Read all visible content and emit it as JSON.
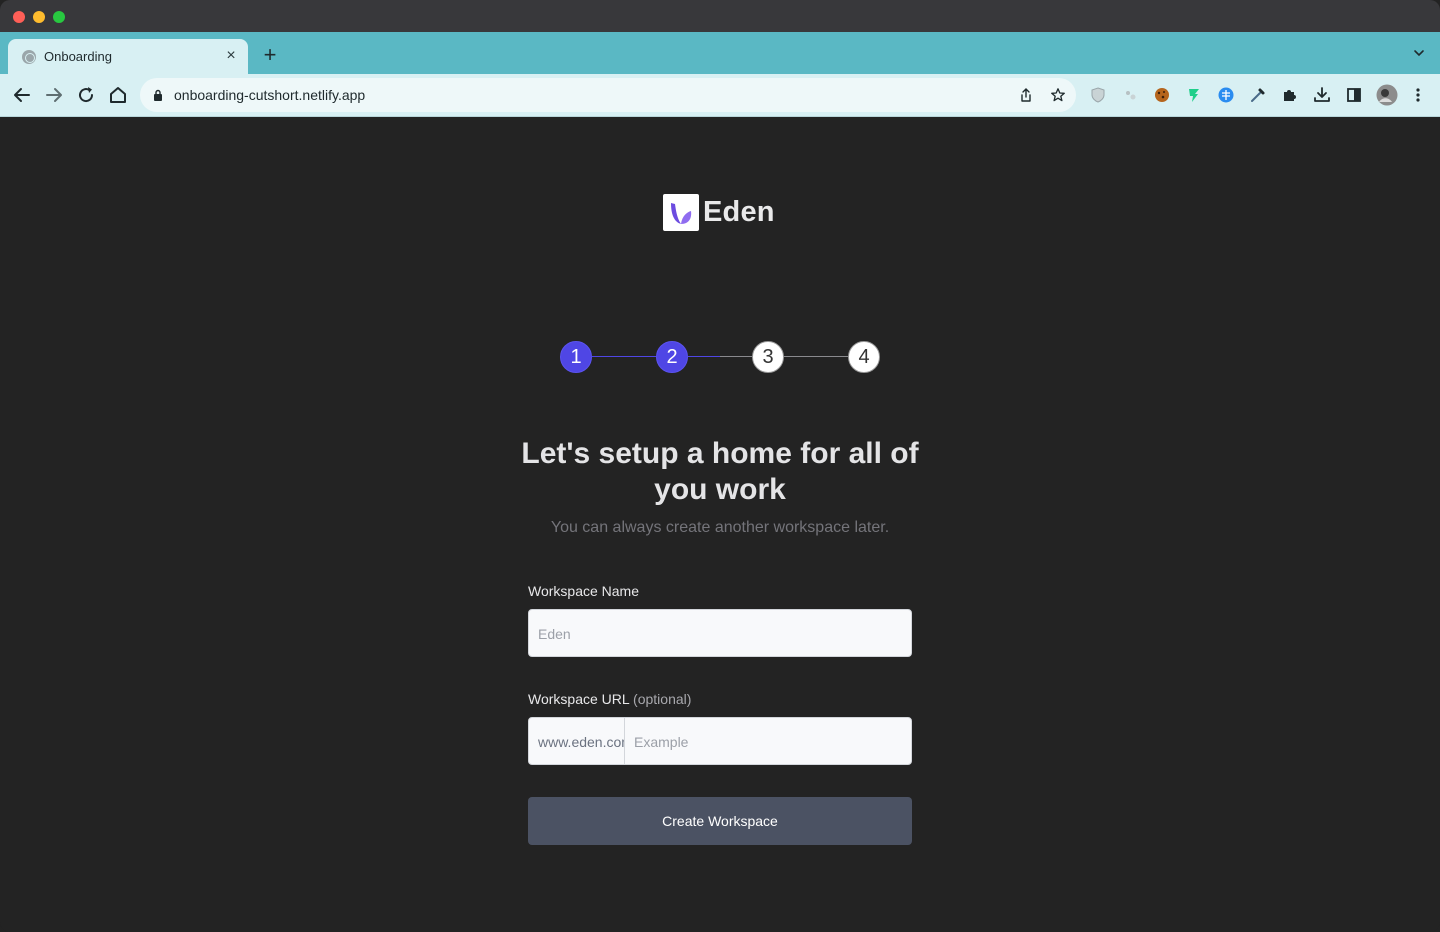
{
  "browser": {
    "tab_title": "Onboarding",
    "tab_close": "×",
    "new_tab": "+",
    "url": "onboarding-cutshort.netlify.app",
    "icons": [
      "back-icon",
      "forward-icon",
      "reload-icon",
      "home-icon",
      "lock-icon",
      "share-icon",
      "star-icon",
      "extensions-puzzle-icon",
      "download-icon",
      "side-panel-icon",
      "profile-avatar",
      "menu-icon"
    ]
  },
  "app": {
    "brand": "Eden",
    "steps": [
      {
        "label": "1",
        "state": "active"
      },
      {
        "label": "2",
        "state": "active"
      },
      {
        "label": "3",
        "state": "idle"
      },
      {
        "label": "4",
        "state": "idle"
      }
    ],
    "heading": "Let's setup a home for all of you work",
    "subtitle": "You can always create another workspace later.",
    "workspace_name": {
      "label": "Workspace Name",
      "placeholder": "Eden"
    },
    "workspace_url": {
      "label": "Workspace URL",
      "label_optional": "(optional)",
      "prefix": "www.eden.com/",
      "placeholder": "Example"
    },
    "submit_label": "Create Workspace",
    "colors": {
      "accent": "#4f46e5",
      "page_bg": "#232323",
      "button_bg": "#4b5263",
      "browser_tab": "#5ab8c4"
    }
  }
}
